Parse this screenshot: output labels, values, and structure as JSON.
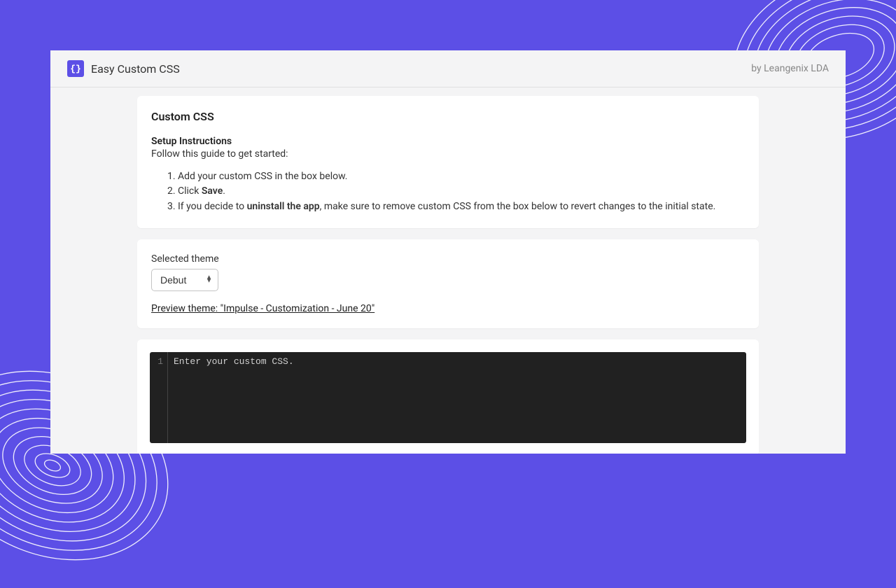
{
  "header": {
    "app_title": "Easy Custom CSS",
    "logo_text": "{}",
    "vendor": "by Leangenix LDA"
  },
  "instructions_card": {
    "title": "Custom CSS",
    "setup_heading": "Setup Instructions",
    "setup_intro": "Follow this guide to get started:",
    "step1": "Add your custom CSS in the box below.",
    "step2_prefix": "Click ",
    "step2_bold": "Save",
    "step2_suffix": ".",
    "step3_prefix": "If you decide to ",
    "step3_bold": "uninstall the app",
    "step3_suffix": ", make sure to remove custom CSS from the box below to revert changes to the initial state."
  },
  "theme_card": {
    "label": "Selected theme",
    "selected_value": "Debut",
    "preview_link": "Preview theme: \"Impulse - Customization - June 20\""
  },
  "editor": {
    "line_number": "1",
    "placeholder": "Enter your custom CSS."
  }
}
